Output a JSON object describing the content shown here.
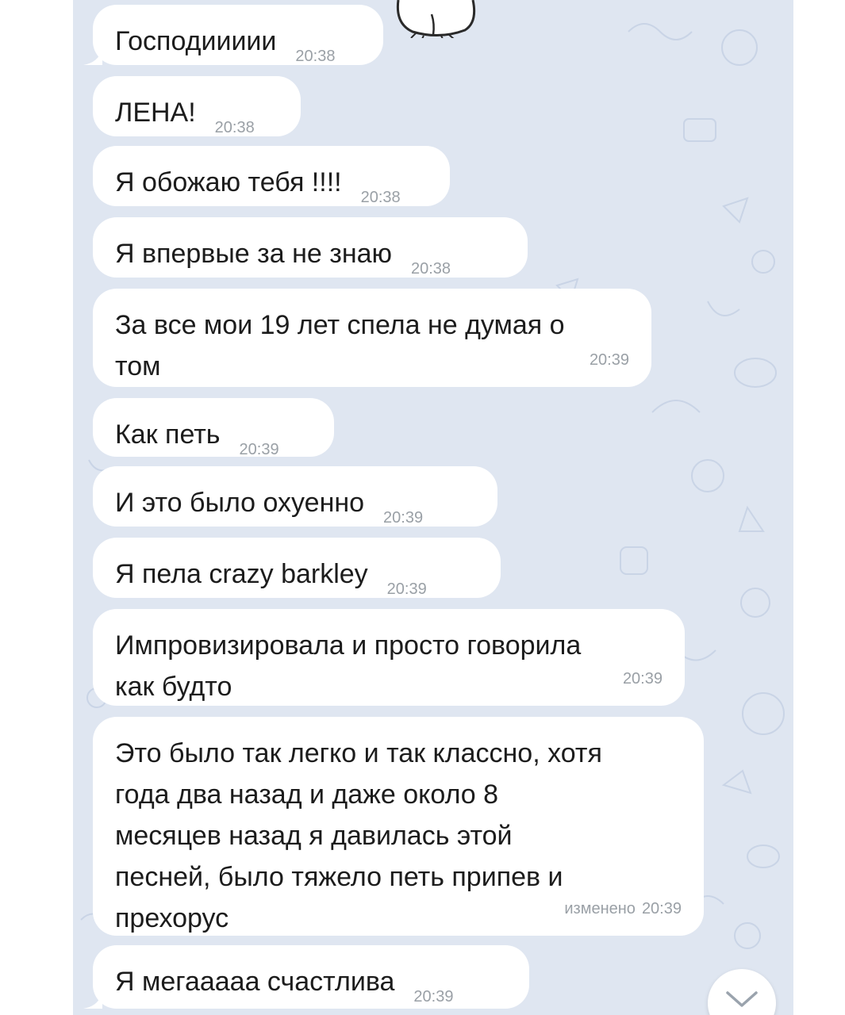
{
  "messages": [
    {
      "text": "Господиииии",
      "time": "20:38"
    },
    {
      "text": "ЛЕНА!",
      "time": "20:38"
    },
    {
      "text": "Я обожаю тебя !!!!",
      "time": "20:38"
    },
    {
      "text": "Я впервые за не знаю",
      "time": "20:38"
    },
    {
      "text": "За все мои 19 лет спела не думая о\nтом",
      "time": "20:39"
    },
    {
      "text": "Как петь",
      "time": "20:39"
    },
    {
      "text": "И это было охуенно",
      "time": "20:39"
    },
    {
      "text": "Я пела crazy barkley",
      "time": "20:39"
    },
    {
      "text": "Импровизировала и просто говорила\nкак будто",
      "time": "20:39"
    },
    {
      "text": "Это было так легко и так классно, хотя\nгода два назад и даже около 8\nмесяцев назад я давилась этой\nпесней, было тяжело петь припев и\nпрехорус",
      "time": "20:39",
      "edited_label": "изменено"
    },
    {
      "text": "Я мегааааа счастлива",
      "time": "20:39"
    }
  ],
  "icons": {
    "sticker": "white-cat-sticker-icon",
    "scroll_down": "chevron-down-icon"
  },
  "colors": {
    "chat_background": "#dfe6f1",
    "bubble": "#ffffff",
    "text": "#1c1c1c",
    "timestamp": "#9aa0a6"
  }
}
